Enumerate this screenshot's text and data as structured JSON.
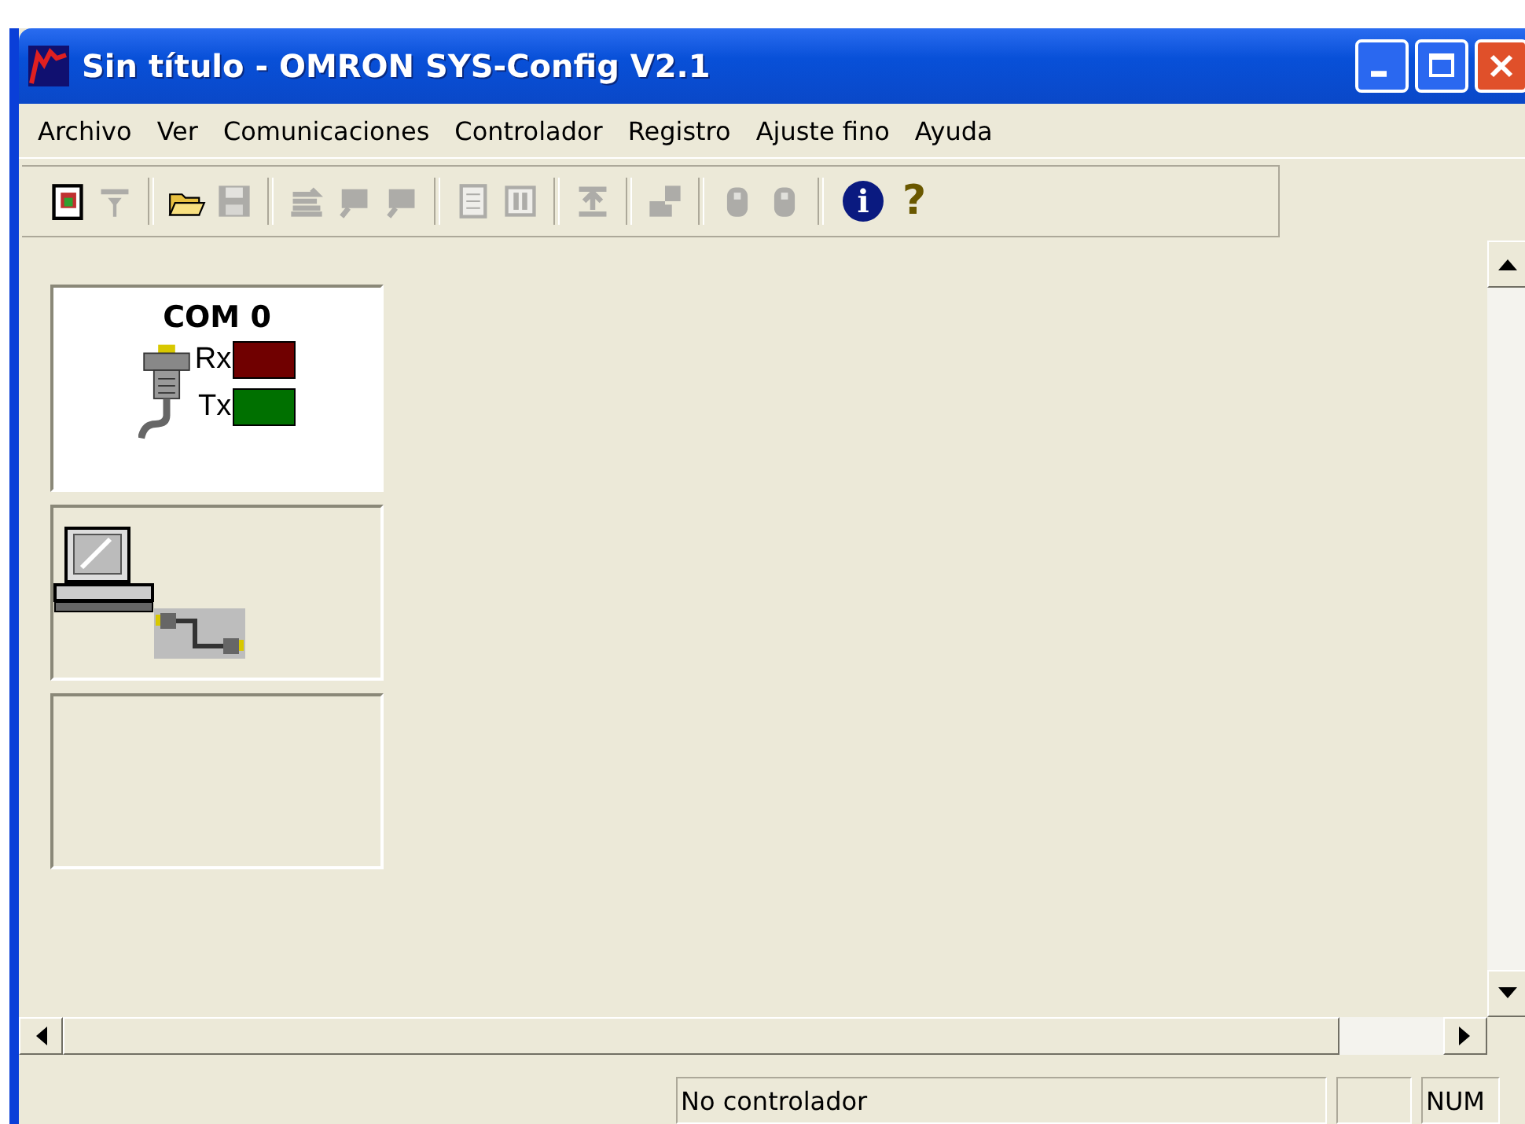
{
  "window": {
    "title": "Sin título - OMRON SYS-Config V2.1"
  },
  "menu": [
    "Archivo",
    "Ver",
    "Comunicaciones",
    "Controlador",
    "Registro",
    "Ajuste fino",
    "Ayuda"
  ],
  "toolbar": [
    [
      {
        "kind": "document",
        "disabled": false
      },
      {
        "kind": "funnel",
        "disabled": true
      }
    ],
    [
      {
        "kind": "folder",
        "disabled": false
      },
      {
        "kind": "disk",
        "disabled": true
      }
    ],
    [
      {
        "kind": "arrows",
        "disabled": true
      },
      {
        "kind": "flag",
        "disabled": true
      },
      {
        "kind": "flag",
        "disabled": true
      }
    ],
    [
      {
        "kind": "page",
        "disabled": true
      },
      {
        "kind": "columns",
        "disabled": true
      }
    ],
    [
      {
        "kind": "upload",
        "disabled": true
      }
    ],
    [
      {
        "kind": "blocks",
        "disabled": true
      }
    ],
    [
      {
        "kind": "mouse",
        "disabled": true
      },
      {
        "kind": "mouse",
        "disabled": true
      }
    ],
    [
      {
        "kind": "info",
        "text": "i",
        "disabled": false
      },
      {
        "kind": "help",
        "text": "?",
        "disabled": false
      }
    ]
  ],
  "port_panel": {
    "title": "COM 0",
    "signals": [
      {
        "label": "Rx",
        "color": "#700000"
      },
      {
        "label": "Tx",
        "color": "#007000"
      }
    ]
  },
  "status_bar": [
    "No controlador",
    "NUM"
  ]
}
